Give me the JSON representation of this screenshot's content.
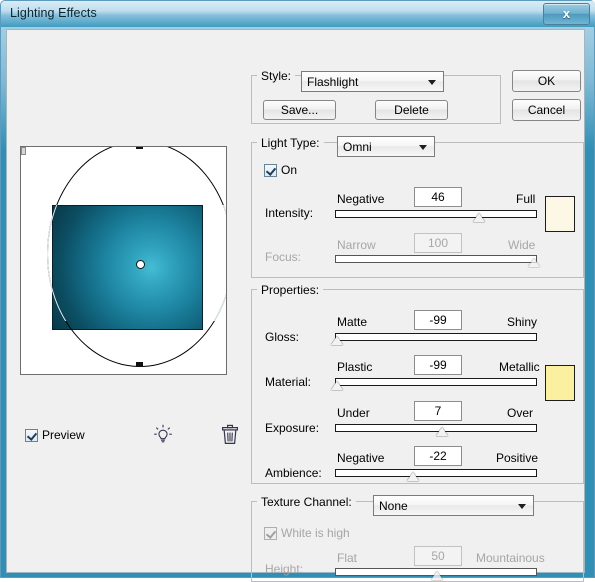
{
  "window": {
    "title": "Lighting Effects",
    "close_label": "x"
  },
  "buttons": {
    "ok": "OK",
    "cancel": "Cancel",
    "save": "Save...",
    "delete": "Delete"
  },
  "style_group": {
    "legend": "Style:",
    "selected": "Flashlight"
  },
  "light_type_group": {
    "legend": "Light Type:",
    "selected": "Omni",
    "on_label": "On",
    "on_checked": true,
    "intensity": {
      "label": "Intensity:",
      "min_label": "Negative",
      "max_label": "Full",
      "value": "46",
      "percent": 72,
      "disabled": false
    },
    "focus": {
      "label": "Focus:",
      "min_label": "Narrow",
      "max_label": "Wide",
      "value": "100",
      "percent": 99,
      "disabled": true
    },
    "color_swatch": "#fdf8e6"
  },
  "properties_group": {
    "legend": "Properties:",
    "gloss": {
      "label": "Gloss:",
      "min_label": "Matte",
      "max_label": "Shiny",
      "value": "-99",
      "percent": 1
    },
    "material": {
      "label": "Material:",
      "min_label": "Plastic",
      "max_label": "Metallic",
      "value": "-99",
      "percent": 1
    },
    "exposure": {
      "label": "Exposure:",
      "min_label": "Under",
      "max_label": "Over",
      "value": "7",
      "percent": 53
    },
    "ambience": {
      "label": "Ambience:",
      "min_label": "Negative",
      "max_label": "Positive",
      "value": "-22",
      "percent": 38
    },
    "color_swatch": "#faf0a0"
  },
  "texture_group": {
    "legend": "Texture Channel:",
    "selected": "None",
    "white_is_high_label": "White is high",
    "white_is_high_checked": true,
    "white_is_high_disabled": true,
    "height": {
      "label": "Height:",
      "min_label": "Flat",
      "max_label": "Mountainous",
      "value": "50",
      "percent": 50,
      "disabled": true
    }
  },
  "preview": {
    "checkbox_label": "Preview",
    "checkbox_checked": true,
    "bulb_icon": "light-bulb-icon",
    "trash_icon": "trash-can-icon",
    "image_center_color": "#46bcd4",
    "image_edge_color": "#093846"
  }
}
